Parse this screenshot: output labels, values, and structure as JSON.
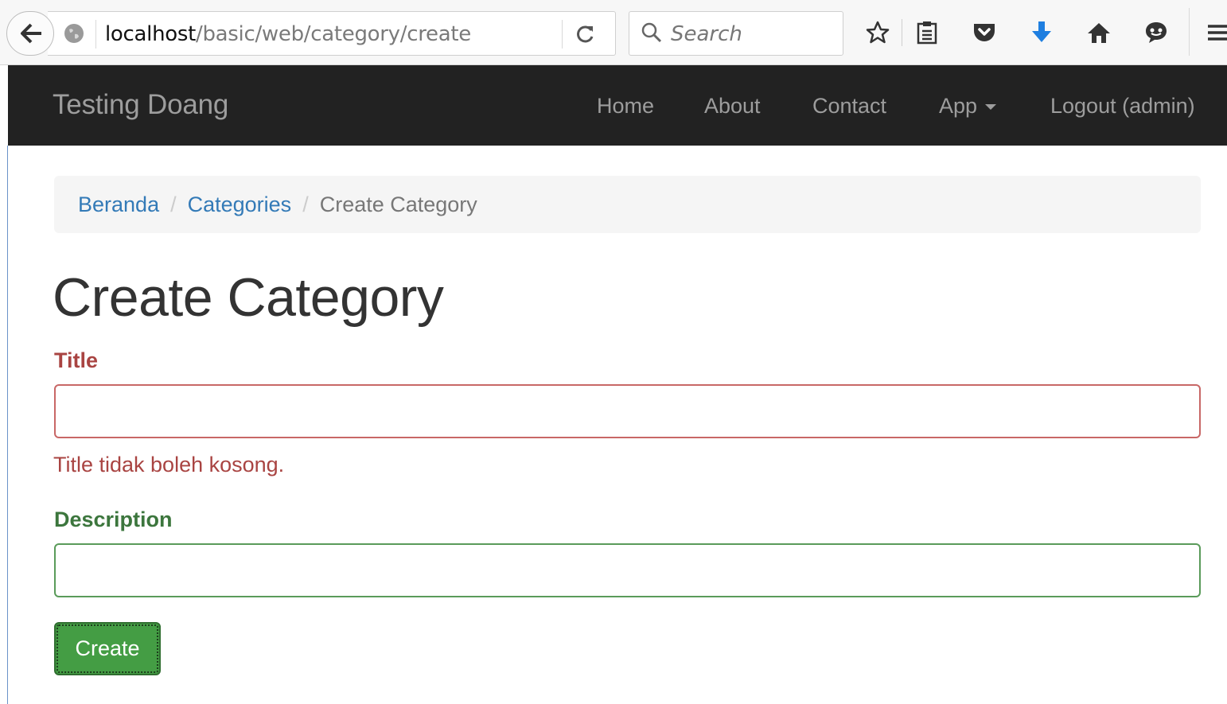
{
  "browser": {
    "url_host": "localhost",
    "url_path": "/basic/web/category/create",
    "search_placeholder": "Search",
    "icons": [
      "back-arrow-icon",
      "globe-icon",
      "reload-icon",
      "search-icon",
      "bookmark-star-icon",
      "reading-list-icon",
      "pocket-icon",
      "download-icon",
      "home-icon",
      "chat-icon",
      "hamburger-menu-icon"
    ]
  },
  "navbar": {
    "brand": "Testing Doang",
    "items": [
      {
        "label": "Home"
      },
      {
        "label": "About"
      },
      {
        "label": "Contact"
      },
      {
        "label": "App"
      },
      {
        "label": "Logout (admin)"
      }
    ]
  },
  "breadcrumb": {
    "items": [
      "Beranda",
      "Categories",
      "Create Category"
    ],
    "separator": "/"
  },
  "page": {
    "title": "Create Category"
  },
  "form": {
    "title_label": "Title",
    "title_value": "",
    "title_error": "Title tidak boleh kosong.",
    "description_label": "Description",
    "description_value": "",
    "submit_label": "Create"
  },
  "colors": {
    "error": "#a94442",
    "success": "#3c763d",
    "link": "#337ab7",
    "navbar_bg": "#222222",
    "button_bg": "#449d44"
  }
}
